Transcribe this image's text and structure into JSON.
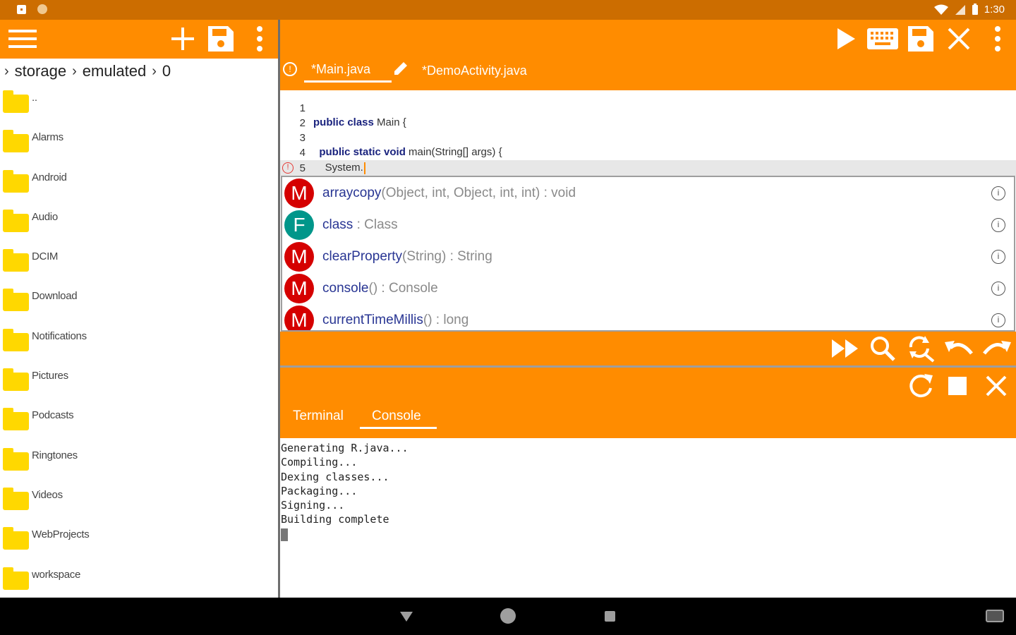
{
  "status_bar": {
    "time": "1:30"
  },
  "file_browser": {
    "breadcrumb": [
      "storage",
      "emulated",
      "0"
    ],
    "items": [
      {
        "name": ".."
      },
      {
        "name": "Alarms"
      },
      {
        "name": "Android"
      },
      {
        "name": "Audio"
      },
      {
        "name": "DCIM"
      },
      {
        "name": "Download"
      },
      {
        "name": "Notifications"
      },
      {
        "name": "Pictures"
      },
      {
        "name": "Podcasts"
      },
      {
        "name": "Ringtones"
      },
      {
        "name": "Videos"
      },
      {
        "name": "WebProjects"
      },
      {
        "name": "workspace"
      }
    ]
  },
  "editor": {
    "tabs": [
      {
        "label": "*Main.java",
        "active": true
      },
      {
        "label": "*DemoActivity.java",
        "active": false
      }
    ],
    "lines": [
      {
        "num": "1",
        "kw": "",
        "rest": ""
      },
      {
        "num": "2",
        "kw": "public class",
        "rest": " Main {"
      },
      {
        "num": "3",
        "kw": "",
        "rest": ""
      },
      {
        "num": "4",
        "kw": "  public static void",
        "rest": " main(String[] args) {"
      },
      {
        "num": "5",
        "kw": "",
        "rest": "    System."
      }
    ],
    "completions": [
      {
        "kind": "M",
        "name": "arraycopy",
        "sig": "(Object, int, Object, int, int) : void"
      },
      {
        "kind": "F",
        "name": "class",
        "sig": " : Class"
      },
      {
        "kind": "M",
        "name": "clearProperty",
        "sig": "(String) : String"
      },
      {
        "kind": "M",
        "name": "console",
        "sig": "() : Console"
      },
      {
        "kind": "M",
        "name": "currentTimeMillis",
        "sig": "() : long"
      }
    ]
  },
  "console": {
    "tabs": [
      {
        "label": "Terminal",
        "active": false
      },
      {
        "label": "Console",
        "active": true
      }
    ],
    "output": [
      "Generating R.java...",
      "Compiling...",
      "Dexing classes...",
      "Packaging...",
      "Signing...",
      "Building complete"
    ]
  },
  "colors": {
    "accent": "#ff8c00",
    "status_bar": "#cc6d00",
    "method_badge": "#d50000",
    "field_badge": "#00968a",
    "folder": "#ffd800"
  },
  "icons": {
    "left_toolbar": [
      "menu-icon",
      "add-icon",
      "save-icon",
      "more-vert-icon"
    ],
    "editor_toolbar": [
      "run-icon",
      "keyboard-icon",
      "save-icon",
      "close-icon",
      "more-vert-icon"
    ],
    "editor_bottom": [
      "fast-forward-icon",
      "search-icon",
      "find-replace-icon",
      "undo-icon",
      "redo-icon"
    ],
    "console_toolbar": [
      "refresh-icon",
      "stop-icon",
      "close-icon"
    ]
  }
}
